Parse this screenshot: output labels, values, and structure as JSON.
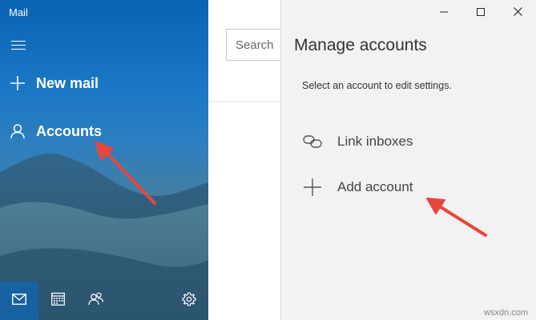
{
  "app": {
    "title": "Mail"
  },
  "nav": {
    "new_mail": {
      "label": "New mail",
      "icon": "plus-icon"
    },
    "accounts": {
      "label": "Accounts",
      "icon": "person-icon"
    },
    "bottom": [
      {
        "icon": "mail-icon",
        "selected": true
      },
      {
        "icon": "calendar-icon"
      },
      {
        "icon": "people-icon"
      },
      {
        "icon": "gear-icon"
      }
    ]
  },
  "search": {
    "placeholder": "Search"
  },
  "flyout": {
    "title": "Manage accounts",
    "subtitle": "Select an account to edit settings.",
    "items": [
      {
        "label": "Link inboxes",
        "icon": "link-icon"
      },
      {
        "label": "Add account",
        "icon": "plus-icon"
      }
    ]
  },
  "window_controls": [
    "minimize",
    "maximize",
    "close"
  ],
  "annotations": {
    "arrows": 2,
    "arrow_color": "#e8463c"
  },
  "watermark": "wsxdn.com",
  "colors": {
    "nav_blue": "#1a78c4",
    "flyout_bg": "#f2f2f2",
    "accent": "#0063b1"
  }
}
